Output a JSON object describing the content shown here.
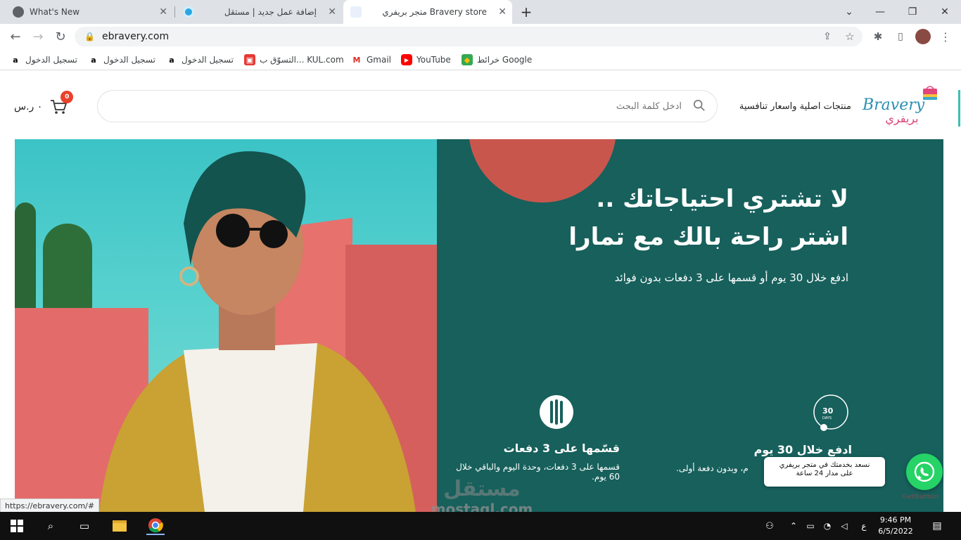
{
  "browser": {
    "tabs": [
      {
        "title": "What's New"
      },
      {
        "title": "إضافة عمل جديد | مستقل"
      },
      {
        "title": "متجر بريفري Bravery store"
      }
    ],
    "new_tab": "+",
    "url": "ebravery.com",
    "bookmarks": [
      {
        "label": "تسجيل الدخول",
        "icon": "amazon-icon"
      },
      {
        "label": "تسجيل الدخول",
        "icon": "amazon-icon"
      },
      {
        "label": "تسجيل الدخول",
        "icon": "amazon-icon"
      },
      {
        "label": "التسوّق ب... KUL.com",
        "icon": "kul-icon"
      },
      {
        "label": "Gmail",
        "icon": "gmail-icon"
      },
      {
        "label": "YouTube",
        "icon": "youtube-icon"
      },
      {
        "label": "خرائط Google",
        "icon": "maps-icon"
      }
    ],
    "status_url": "https://ebravery.com/#"
  },
  "header": {
    "logo_text": "Bravery",
    "logo_text_ar": "بريفري",
    "tagline": "منتجات اصلية واسعار تنافسية",
    "search_placeholder": "ادخل كلمة البحث",
    "cart_amount": "٠ ر.س",
    "cart_count": "0"
  },
  "hero": {
    "title_line1": "لا تشتري احتياجاتك ..",
    "title_line2": "اشتر راحة بالك مع تمارا",
    "subtitle": "ادفع خلال 30 يوم أو قسمها على 3 دفعات بدون فوائد",
    "features": [
      {
        "icon": "installments-icon",
        "title": "قسّمها على 3 دفعات",
        "desc": "قسمها على 3 دفعات، وحدة اليوم والباقي خلال 60 يوم."
      },
      {
        "icon": "30-days-icon",
        "icon_text": "30",
        "icon_sub": "DAYS",
        "title": "ادفع خلال 30 يوم",
        "desc": "م، وبدون دفعة أولى."
      }
    ]
  },
  "whatsapp": {
    "bubble_line1": "نسعد بخدمتك في متجر بريفري",
    "bubble_line2": "على مدار 24 ساعة",
    "credit": "GetButton"
  },
  "watermark": {
    "line1": "مستقل",
    "line2": "mostaql.com"
  },
  "taskbar": {
    "time": "9:46 PM",
    "date": "6/5/2022",
    "lang": "ع"
  },
  "colors": {
    "accent": "#e8412c",
    "hero_bg": "#17605c",
    "whatsapp": "#25d366"
  }
}
